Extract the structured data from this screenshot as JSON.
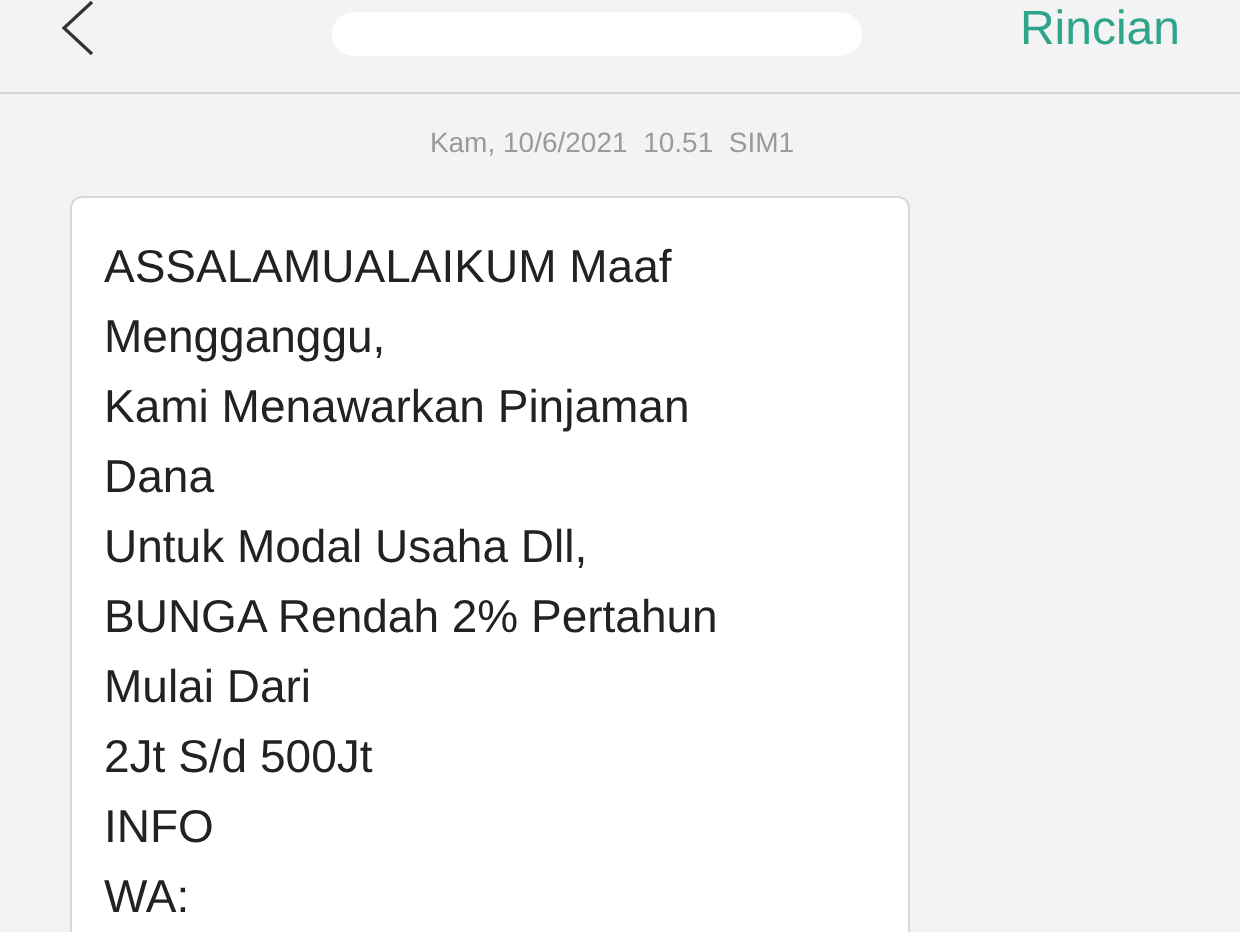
{
  "header": {
    "action": "Rincian"
  },
  "timestamp": "Kam, 10/6/2021  10.51  SIM1",
  "message": {
    "lines": [
      "ASSALAMUALAIKUM Maaf",
      "Mengganggu,",
      "Kami Menawarkan Pinjaman",
      "Dana",
      "Untuk Modal Usaha Dll,",
      "BUNGA Rendah 2% Pertahun",
      "Mulai Dari",
      "2Jt S/d 500Jt",
      "INFO",
      "WA:"
    ]
  }
}
